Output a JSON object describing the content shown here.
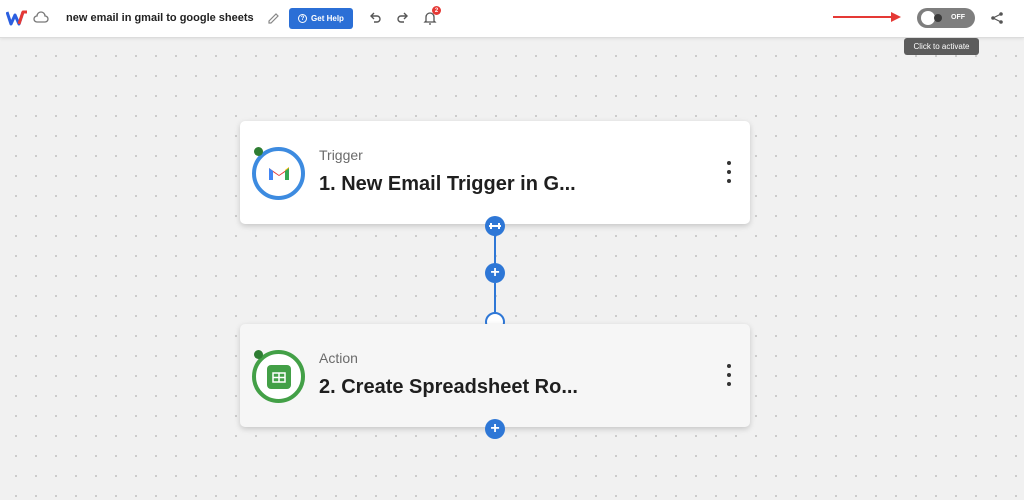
{
  "header": {
    "title": "new email in gmail to google sheets",
    "help_label": "Get Help",
    "notification_count": "2",
    "toggle_label": "OFF",
    "toggle_tooltip": "Click to activate"
  },
  "colors": {
    "accent": "#2b6fd6",
    "toggle_off": "#7e7e7e",
    "annotation_arrow": "#e53935",
    "trigger_ring": "#3d8be0",
    "action_ring": "#43a047",
    "status_dot": "#2e7d32"
  },
  "workflow": {
    "steps": [
      {
        "kind": "Trigger",
        "name": "1. New Email Trigger in G...",
        "app_icon": "gmail-icon"
      },
      {
        "kind": "Action",
        "name": "2. Create Spreadsheet Ro...",
        "app_icon": "google-sheets-icon"
      }
    ]
  }
}
